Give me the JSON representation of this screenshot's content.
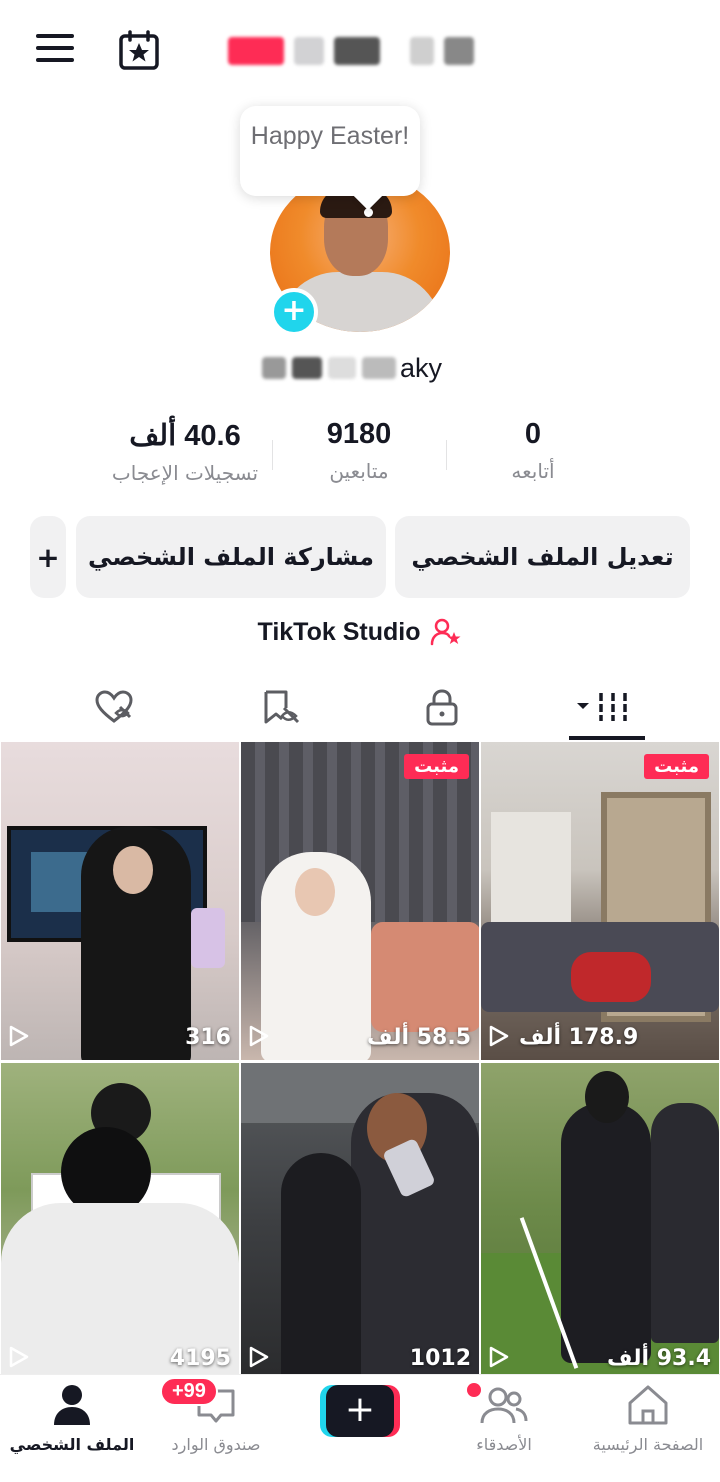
{
  "profile": {
    "bubble_text": "Happy Easter!",
    "handle_visible": "aky"
  },
  "stats": {
    "likes": {
      "value": "40.6 ألف",
      "label": "تسجيلات الإعجاب"
    },
    "followers": {
      "value": "9180",
      "label": "متابعين"
    },
    "following": {
      "value": "0",
      "label": "أتابعه"
    }
  },
  "buttons": {
    "edit_profile": "تعديل الملف الشخصي",
    "share_profile": "مشاركة الملف الشخصي",
    "add": "+"
  },
  "studio": {
    "label": "TikTok Studio"
  },
  "tabs": [
    "videos-icon",
    "lock-icon",
    "favorites-icon",
    "liked-icon"
  ],
  "videos": [
    {
      "views": "178.9 ألف",
      "pinned": true,
      "pinned_label": "مثبت"
    },
    {
      "views": "58.5 ألف",
      "pinned": true,
      "pinned_label": "مثبت"
    },
    {
      "views": "316",
      "pinned": false
    },
    {
      "views": "93.4 ألف",
      "pinned": false
    },
    {
      "views": "1012",
      "pinned": false
    },
    {
      "views": "4195",
      "pinned": false
    }
  ],
  "nav": {
    "home": "الصفحة الرئيسية",
    "friends": "الأصدقاء",
    "create": "+",
    "inbox": "صندوق الوارد",
    "inbox_badge": "+99",
    "profile": "الملف الشخصي"
  },
  "colors": {
    "accent": "#fe2c55",
    "cyan": "#20d5ec",
    "text": "#161823",
    "muted": "#8a8b91"
  }
}
